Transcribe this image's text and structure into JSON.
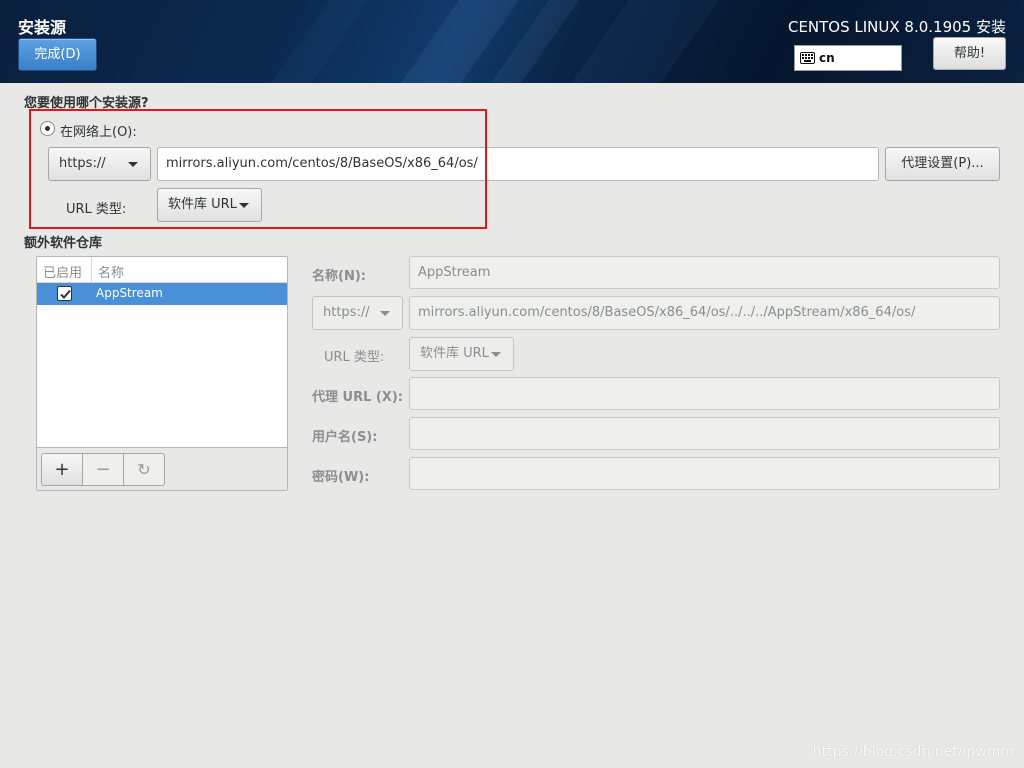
{
  "header": {
    "spoke_title": "安装源",
    "done_button": "完成(D)",
    "product_title": "CENTOS LINUX 8.0.1905 安装",
    "keyboard_layout": "cn",
    "help_button": "帮助!"
  },
  "source": {
    "question": "您要使用哪个安装源?",
    "network_radio_label": "在网络上(O):",
    "protocol": "https://",
    "url": "mirrors.aliyun.com/centos/8/BaseOS/x86_64/os/",
    "proxy_button": "代理设置(P)...",
    "url_type_label": "URL 类型:",
    "url_type_value": "软件库 URL"
  },
  "repos": {
    "title": "额外软件仓库",
    "col_enabled": "已启用",
    "col_name": "名称",
    "items": [
      {
        "name": "AppStream",
        "enabled": true
      }
    ],
    "add_label": "+",
    "remove_label": "−",
    "refresh_label": "↻"
  },
  "repo_form": {
    "name_label": "名称(N):",
    "name_value": "AppStream",
    "protocol": "https://",
    "url": "mirrors.aliyun.com/centos/8/BaseOS/x86_64/os/../../../AppStream/x86_64/os/",
    "url_type_label": "URL 类型:",
    "url_type_value": "软件库 URL",
    "proxy_url_label": "代理 URL (X):",
    "proxy_url_value": "",
    "username_label": "用户名(S):",
    "username_value": "",
    "password_label": "密码(W):",
    "password_value": ""
  },
  "watermark": "https://blog.csdn.net/ipwmm",
  "colors": {
    "accent": "#4a90d9",
    "highlight_border": "#e3161d",
    "header_bg": "#0c2b52"
  }
}
